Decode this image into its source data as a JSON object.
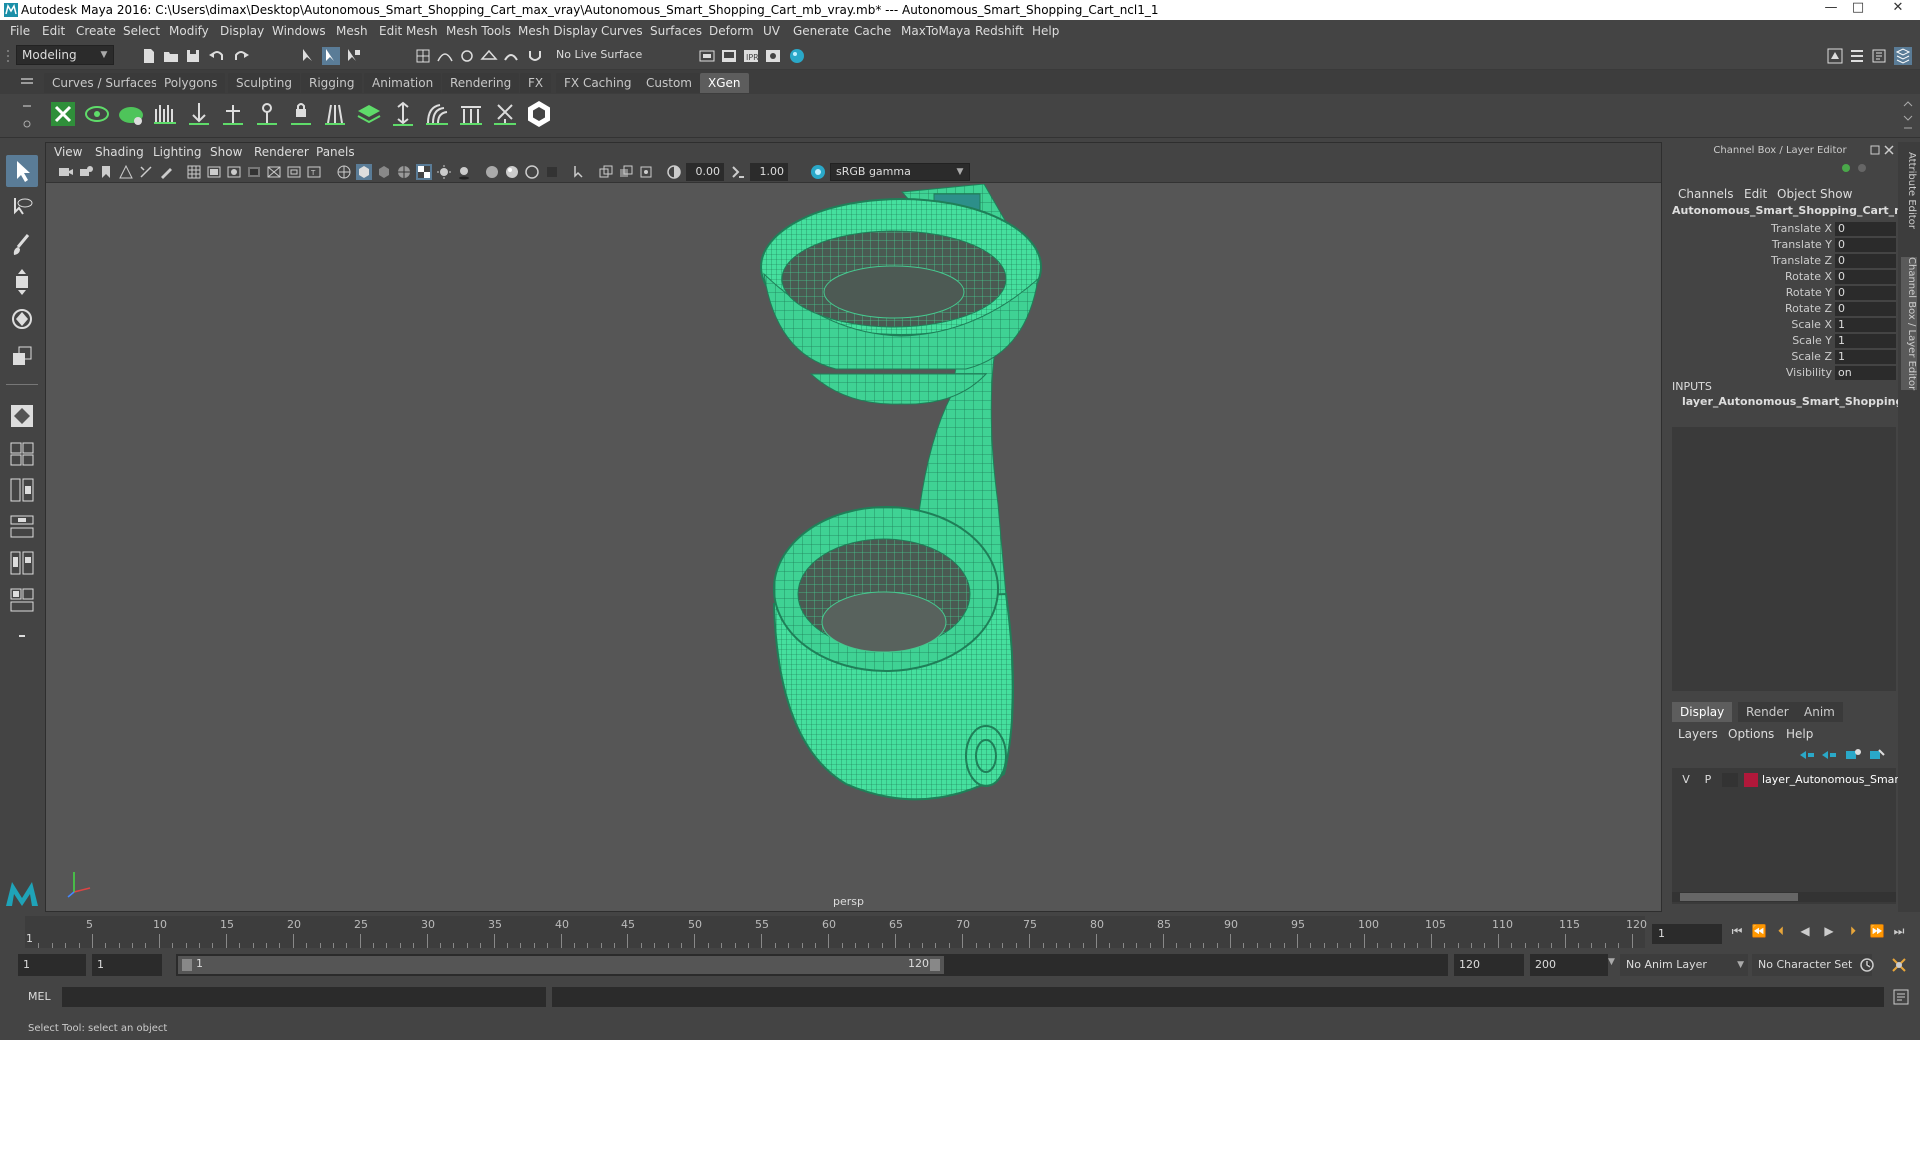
{
  "window": {
    "title": "Autodesk Maya 2016: C:\\Users\\dimax\\Desktop\\Autonomous_Smart_Shopping_Cart_max_vray\\Autonomous_Smart_Shopping_Cart_mb_vray.mb*   ---   Autonomous_Smart_Shopping_Cart_ncl1_1",
    "minimize": "—",
    "maximize": "□",
    "close": "✕"
  },
  "menubar": [
    "File",
    "Edit",
    "Create",
    "Select",
    "Modify",
    "Display",
    "Windows",
    "Mesh",
    "Edit Mesh",
    "Mesh Tools",
    "Mesh Display",
    "Curves",
    "Surfaces",
    "Deform",
    "UV",
    "Generate",
    "Cache",
    "MaxToMaya",
    "Redshift",
    "Help"
  ],
  "statusline": {
    "mode": "Modeling",
    "live_surface": "No Live Surface"
  },
  "shelf_tabs": [
    {
      "label": "Curves / Surfaces",
      "active": false
    },
    {
      "label": "Polygons",
      "active": false
    },
    {
      "label": "Sculpting",
      "active": false
    },
    {
      "label": "Rigging",
      "active": false
    },
    {
      "label": "Animation",
      "active": false
    },
    {
      "label": "Rendering",
      "active": false
    },
    {
      "label": "FX",
      "active": false
    },
    {
      "label": "FX Caching",
      "active": false
    },
    {
      "label": "Custom",
      "active": false
    },
    {
      "label": "XGen",
      "active": true
    }
  ],
  "viewport": {
    "menu": [
      "View",
      "Shading",
      "Lighting",
      "Show",
      "Renderer",
      "Panels"
    ],
    "exposure": "0.00",
    "gamma": "1.00",
    "color_space": "sRGB gamma",
    "camera_label": "persp"
  },
  "channel_box": {
    "header": "Channel Box / Layer Editor",
    "menu": [
      "Channels",
      "Edit",
      "Object",
      "Show"
    ],
    "object_name": "Autonomous_Smart_Shopping_Cart_ncl...",
    "attributes": [
      {
        "label": "Translate X",
        "value": "0"
      },
      {
        "label": "Translate Y",
        "value": "0"
      },
      {
        "label": "Translate Z",
        "value": "0"
      },
      {
        "label": "Rotate X",
        "value": "0"
      },
      {
        "label": "Rotate Y",
        "value": "0"
      },
      {
        "label": "Rotate Z",
        "value": "0"
      },
      {
        "label": "Scale X",
        "value": "1"
      },
      {
        "label": "Scale Y",
        "value": "1"
      },
      {
        "label": "Scale Z",
        "value": "1"
      },
      {
        "label": "Visibility",
        "value": "on"
      }
    ],
    "inputs_label": "INPUTS",
    "input_item": "layer_Autonomous_Smart_Shopping_..."
  },
  "layer_editor": {
    "tabs": [
      {
        "label": "Display",
        "active": true
      },
      {
        "label": "Render",
        "active": false
      },
      {
        "label": "Anim",
        "active": false
      }
    ],
    "menu": [
      "Layers",
      "Options",
      "Help"
    ],
    "layer": {
      "v": "V",
      "p": "P",
      "name": "layer_Autonomous_Smar",
      "color": "#b0183a"
    }
  },
  "side_tabs": [
    "Attribute Editor",
    "Channel Box / Layer Editor"
  ],
  "timeline": {
    "ticks": [
      "5",
      "10",
      "15",
      "20",
      "25",
      "30",
      "35",
      "40",
      "45",
      "50",
      "55",
      "60",
      "65",
      "70",
      "75",
      "80",
      "85",
      "90",
      "95",
      "100",
      "105",
      "110",
      "115",
      "120"
    ],
    "start_label": "1",
    "current_frame": "1"
  },
  "range": {
    "start": "1",
    "playback_start": "1",
    "slider_start": "1",
    "slider_end": "120",
    "playback_end": "120",
    "end": "200",
    "anim_layer": "No Anim Layer",
    "character_set": "No Character Set"
  },
  "command": {
    "lang": "MEL"
  },
  "help_line": "Select Tool: select an object",
  "colors": {
    "wireframe": "#49e3a1",
    "wireframe_dark": "#1f7f58",
    "viewport_bg": "#565656",
    "highlight": "#5a7c97"
  }
}
